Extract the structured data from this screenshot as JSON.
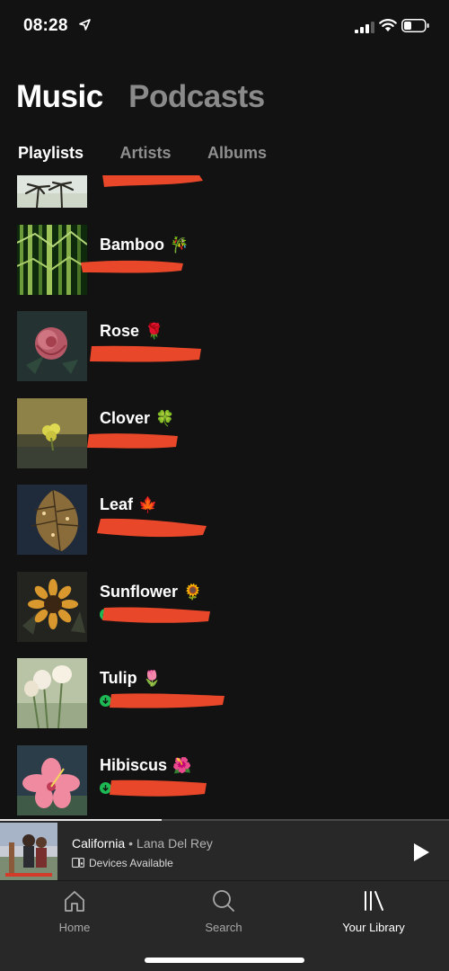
{
  "status_bar": {
    "time": "08:28"
  },
  "header": {
    "tabs": [
      {
        "label": "Music",
        "active": true
      },
      {
        "label": "Podcasts",
        "active": false
      }
    ],
    "subtabs": [
      {
        "label": "Playlists",
        "active": true
      },
      {
        "label": "Artists",
        "active": false
      },
      {
        "label": "Albums",
        "active": false
      }
    ]
  },
  "playlists": [
    {
      "title": "",
      "emoji": "",
      "downloaded": false
    },
    {
      "title": "Bamboo",
      "emoji": "🎋",
      "downloaded": false
    },
    {
      "title": "Rose",
      "emoji": "🌹",
      "downloaded": true
    },
    {
      "title": "Clover",
      "emoji": "🍀",
      "downloaded": false
    },
    {
      "title": "Leaf",
      "emoji": "🍁",
      "downloaded": true
    },
    {
      "title": "Sunflower",
      "emoji": "🌻",
      "downloaded": true
    },
    {
      "title": "Tulip",
      "emoji": "🌷",
      "downloaded": true
    },
    {
      "title": "Hibiscus",
      "emoji": "🌺",
      "downloaded": true
    }
  ],
  "now_playing": {
    "track": "California",
    "separator": "•",
    "artist": "Lana Del Rey",
    "devices": "Devices Available",
    "progress": 0.36
  },
  "bottom_nav": [
    {
      "label": "Home",
      "icon": "home-icon",
      "active": false
    },
    {
      "label": "Search",
      "icon": "search-icon",
      "active": false
    },
    {
      "label": "Your Library",
      "icon": "library-icon",
      "active": true
    }
  ],
  "colors": {
    "background": "#121212",
    "accent_green": "#1db954",
    "redaction": "#e8472a",
    "bar": "#282828"
  }
}
